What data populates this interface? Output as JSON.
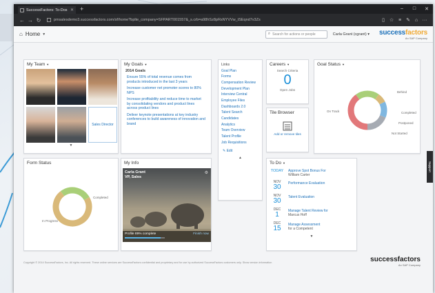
{
  "browser": {
    "tab_label": "SuccessFactors: To-Dos",
    "url": "pmsalesdemo3.successfactors.com/sf/home?bplte_company=SFPART001557&_s.crb=a98hSz8pRsNYVVw_tSEqnd7v3Zs"
  },
  "header": {
    "home_label": "Home",
    "search_placeholder": "Search for actions or people",
    "user_name": "Carla Grant (cgrant)",
    "logo_text_a": "success",
    "logo_text_b": "factors",
    "logo_sub": "An SAP Company"
  },
  "tiles": {
    "my_team": {
      "title": "My Team",
      "sales_director": "Sales Director"
    },
    "my_goals": {
      "title": "My Goals",
      "heading": "2014 Goals",
      "goals": [
        "Ensure 55% of total revenue comes from products introduced in the last 3 years",
        "Increase customer net promoter scores to 80% NPS",
        "Increase profitability and reduce time to market by consolidating vendors and product lines across product lines",
        "Deliver keynote presentations at key industry conferences to build awareness of innovation and brand"
      ]
    },
    "links": {
      "header": "Links",
      "items": [
        "Goal Plan",
        "Forms",
        "Compensation Review",
        "Development Plan",
        "Interview Central",
        "Employee Files",
        "Dashboards 2.0",
        "Talent Search",
        "Candidates",
        "Analytics",
        "Team Overview",
        "Talent Profile",
        "Job Requisitions"
      ],
      "edit_label": "Edit"
    },
    "careers": {
      "title": "Careers",
      "subtitle": "Search Criteria",
      "count": "0",
      "caption": "Open Jobs"
    },
    "tile_browser": {
      "title": "Tile Browser",
      "caption": "Add or remove tiles"
    },
    "goal_status": {
      "title": "Goal Status",
      "labels": [
        "Behind",
        "On Track",
        "Completed",
        "Not Started",
        "Postponed"
      ]
    },
    "form_status": {
      "title": "Form Status",
      "labels": [
        "Completed",
        "In Progress"
      ]
    },
    "my_info": {
      "title": "My Info",
      "name": "Carla Grant",
      "role": "VP, Sales",
      "profile_status": "Profile 89% complete",
      "finish_label": "Finish now",
      "progress": 0.89
    },
    "todo": {
      "title": "To Do",
      "items": [
        {
          "month": "TODAY",
          "day": "",
          "text": "Approve Spot Bonus For",
          "sub": "William Carter"
        },
        {
          "month": "NOV",
          "day": "30",
          "text": "Performance Evaluation",
          "sub": ""
        },
        {
          "month": "NOV",
          "day": "30",
          "text": "Talent Evaluation",
          "sub": ""
        },
        {
          "month": "DEC",
          "day": "1",
          "text": "Manage Talent Review for",
          "sub": "Marcus Hoff"
        },
        {
          "month": "DEC",
          "day": "15",
          "text": "Manage Assessment",
          "sub": "for a Competent"
        }
      ]
    }
  },
  "footer": {
    "copyright": "Copyright © 2014 SuccessFactors, Inc. All rights reserved. These online services are SuccessFactors confidential and proprietary and for use by authorized SuccessFactors customers only. Show version information",
    "logo_text": "successfactors",
    "logo_sub": "An SAP Company"
  },
  "support_label": "Support",
  "colors": {
    "accent": "#1a6fb8",
    "brand_orange": "#f0a830",
    "donut_red": "#e2787a",
    "donut_green": "#a9cf78",
    "donut_blue": "#7fb7e0",
    "donut_tan": "#d9b979",
    "donut_gray": "#a6abb3"
  }
}
